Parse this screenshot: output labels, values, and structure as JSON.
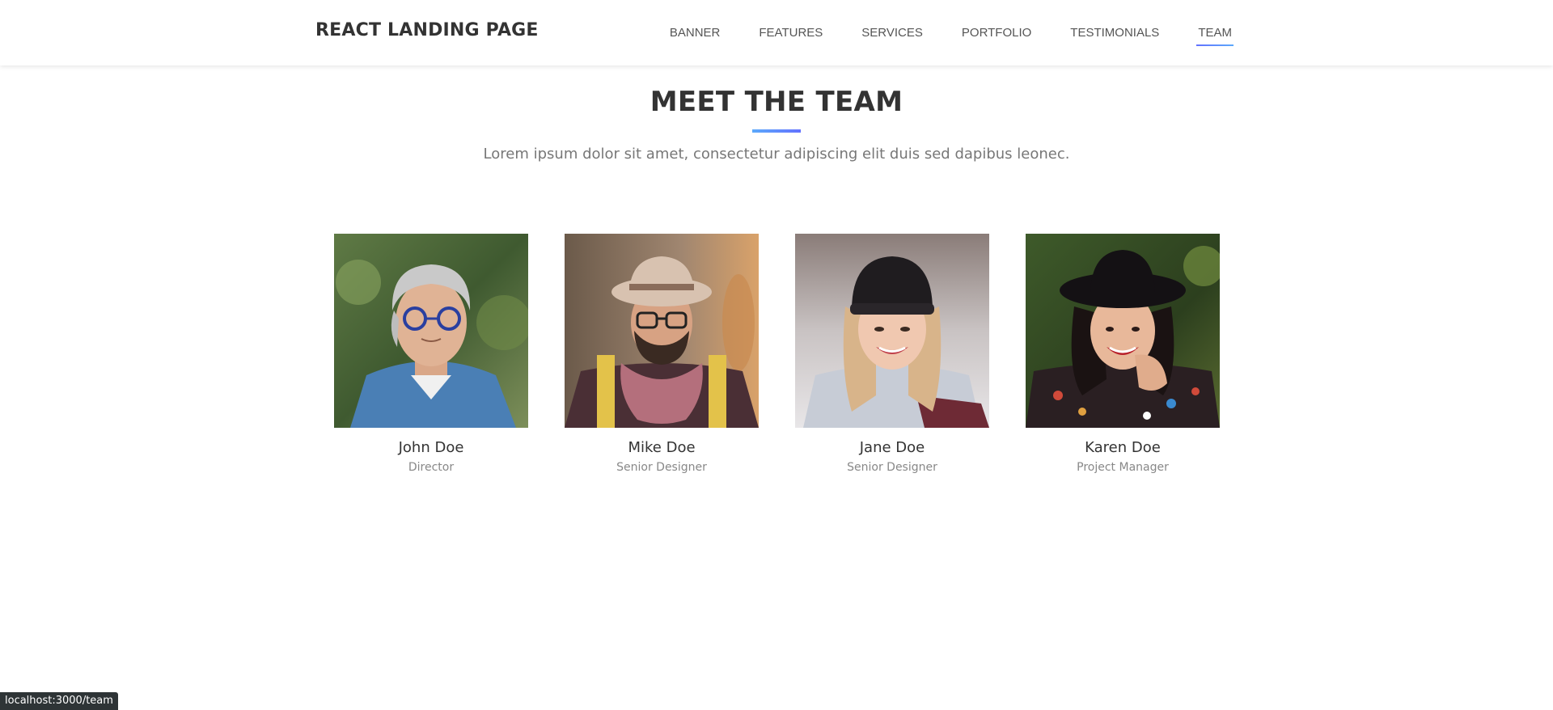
{
  "navbar": {
    "brand": "REACT LANDING PAGE",
    "items": [
      {
        "label": "BANNER"
      },
      {
        "label": "FEATURES"
      },
      {
        "label": "SERVICES"
      },
      {
        "label": "PORTFOLIO"
      },
      {
        "label": "TESTIMONIALS"
      },
      {
        "label": "TEAM",
        "active": true
      }
    ]
  },
  "team": {
    "title": "MEET THE TEAM",
    "subtitle": "Lorem ipsum dolor sit amet, consectetur adipiscing elit duis sed dapibus leonec.",
    "members": [
      {
        "name": "John Doe",
        "role": "Director"
      },
      {
        "name": "Mike Doe",
        "role": "Senior Designer"
      },
      {
        "name": "Jane Doe",
        "role": "Senior Designer"
      },
      {
        "name": "Karen Doe",
        "role": "Project Manager"
      }
    ]
  },
  "status_bar": {
    "url": "localhost:3000/team"
  },
  "colors": {
    "accent_start": "#6372ff",
    "accent_end": "#5ca9fb",
    "heading": "#333333",
    "muted": "#777777"
  }
}
